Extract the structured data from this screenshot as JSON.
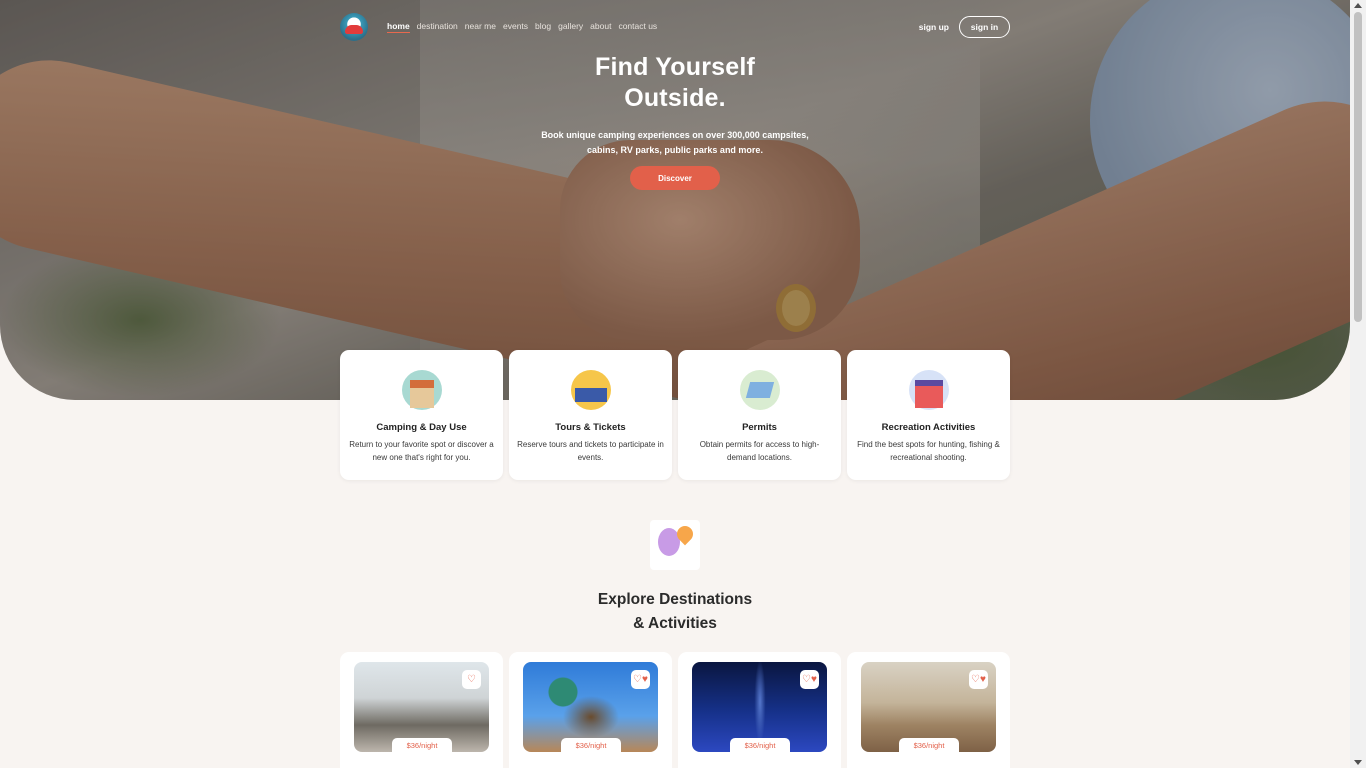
{
  "nav": {
    "links": [
      "home",
      "destination",
      "near me",
      "events",
      "blog",
      "gallery",
      "about",
      "contact us"
    ],
    "signup": "sign up",
    "signin": "sign in"
  },
  "hero": {
    "title_line1": "Find Yourself",
    "title_line2": "Outside.",
    "subtitle_line1": "Book unique camping experiences on over 300,000 campsites,",
    "subtitle_line2": "cabins, RV parks, public parks and more.",
    "button": "Discover"
  },
  "services": [
    {
      "title": "Camping & Day Use",
      "desc": "Return to your favorite spot or discover a new one that's right for you.",
      "icon": "cabin-icon"
    },
    {
      "title": "Tours & Tickets",
      "desc": "Reserve tours and tickets to participate in events.",
      "icon": "tour-icon"
    },
    {
      "title": "Permits",
      "desc": "Obtain permits for access to high-demand locations.",
      "icon": "permit-icon"
    },
    {
      "title": "Recreation Activities",
      "desc": "Find the best spots for hunting, fishing & recreational shooting.",
      "icon": "recreation-icon"
    }
  ],
  "explore": {
    "title_line1": "Explore Destinations",
    "title_line2": "& Activities"
  },
  "destinations": [
    {
      "price": "$36/night",
      "fav_icon": "♡"
    },
    {
      "price": "$36/night",
      "fav_icon": "♡♥"
    },
    {
      "price": "$36/night",
      "fav_icon": "♡♥"
    },
    {
      "price": "$36/night",
      "fav_icon": "♡♥"
    }
  ],
  "colors": {
    "accent": "#e2604a",
    "background": "#f8f4f1"
  }
}
